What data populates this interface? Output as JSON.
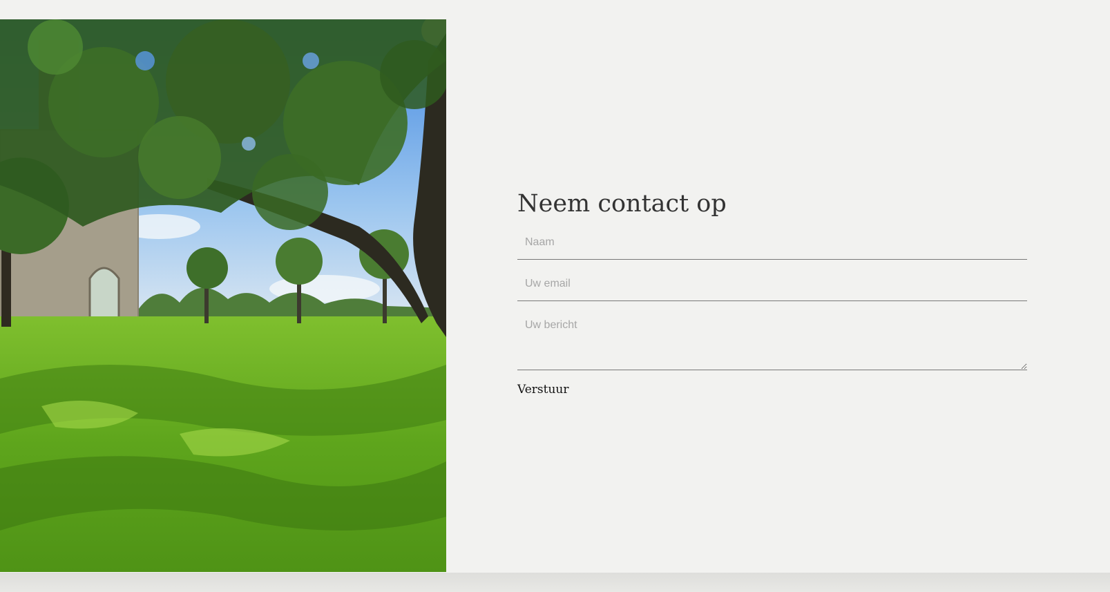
{
  "contact": {
    "title": "Neem contact op",
    "name_placeholder": "Naam",
    "email_placeholder": "Uw email",
    "message_placeholder": "Uw bericht",
    "submit_label": "Verstuur"
  },
  "colors": {
    "background": "#f2f2f0",
    "text": "#333333",
    "placeholder": "#a6a6a6",
    "underline": "#777777"
  }
}
